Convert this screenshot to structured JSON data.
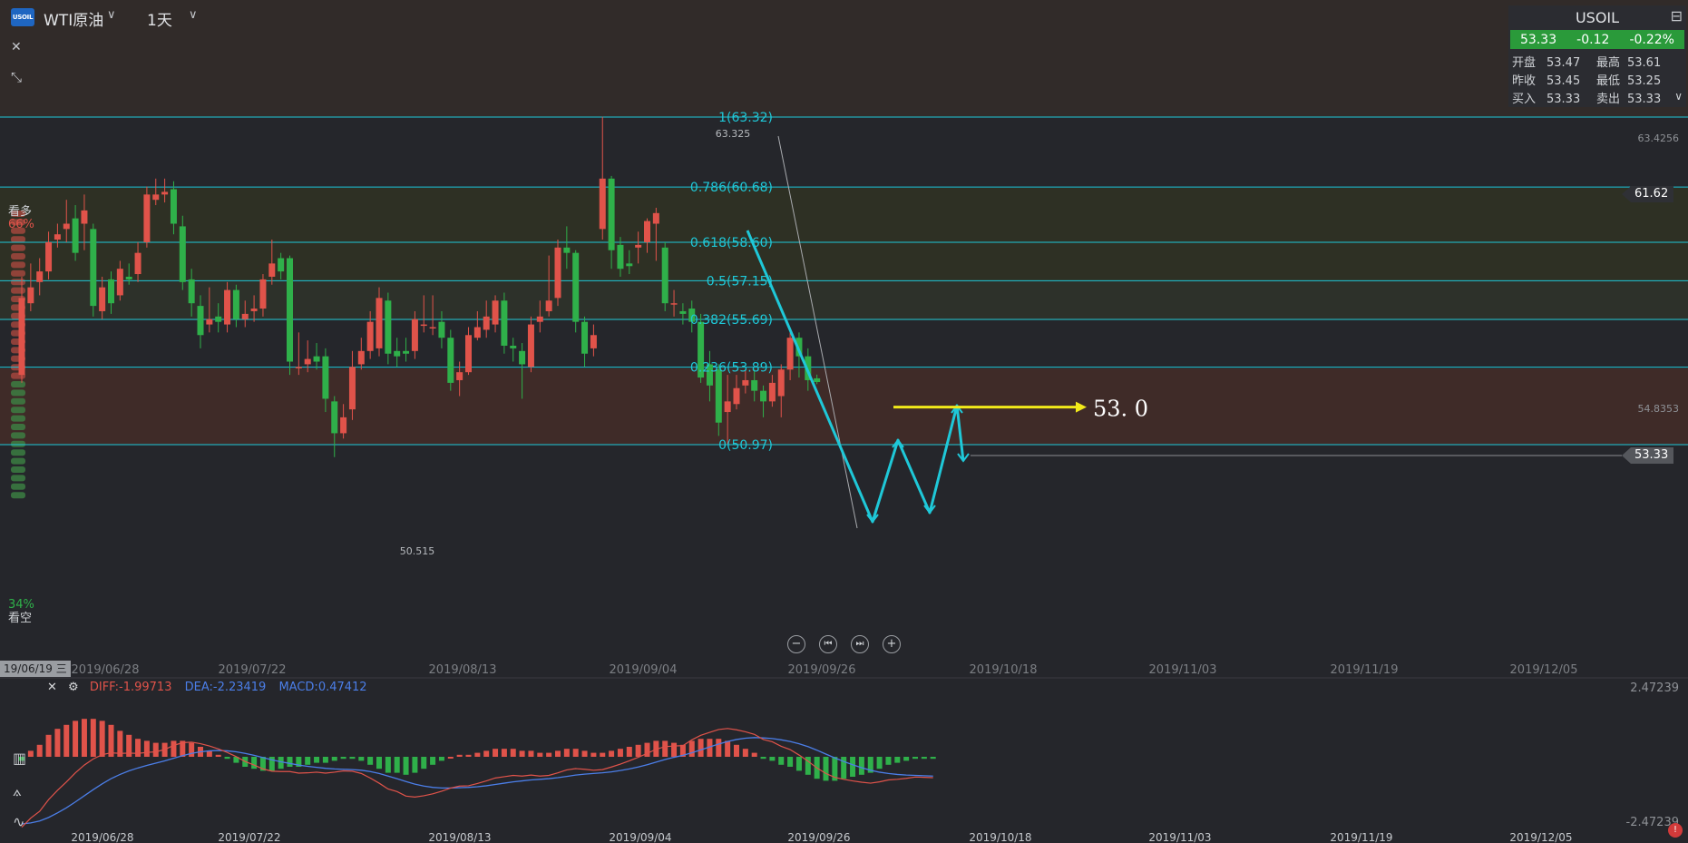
{
  "header": {
    "logo_text": "USOIL",
    "symbol_name": "WTI原油",
    "period": "1天"
  },
  "quote": {
    "title": "USOIL",
    "last": "53.33",
    "change": "-0.12",
    "change_pct": "-0.22%",
    "rows": [
      {
        "l1": "开盘",
        "v1": "53.47",
        "l2": "最高",
        "v2": "53.61"
      },
      {
        "l1": "昨收",
        "v1": "53.45",
        "l2": "最低",
        "v2": "53.25"
      },
      {
        "l1": "买入",
        "v1": "53.33",
        "l2": "卖出",
        "v2": "53.33"
      }
    ]
  },
  "sentiment": {
    "bull_label": "看多",
    "bull_pct": "66%",
    "bear_label": "看空",
    "bear_pct": "34%"
  },
  "price_axis": {
    "top_label": "63.4256",
    "mid_label": "54.8353",
    "tag_high": "61.62",
    "tag_last": "53.33"
  },
  "macd": {
    "date_badge": "19/06/19 三",
    "diff": "DIFF:-1.99713",
    "dea": "DEA:-2.23419",
    "macd": "MACD:0.47412",
    "axis_top": "2.47239",
    "axis_bottom": "-2.47239"
  },
  "colors": {
    "up": "#e0534a",
    "down": "#2fb04a",
    "fib": "#1fc8d8",
    "arrow": "#f2ea1a",
    "dea": "#4b7ee8"
  },
  "chart_data": {
    "type": "candlestick",
    "ylim": [
      49.4,
      65.6
    ],
    "x_dates": [
      "2019/06/28",
      "2019/07/22",
      "2019/08/13",
      "2019/09/04",
      "2019/09/26",
      "2019/10/18",
      "2019/11/03",
      "2019/11/19",
      "2019/12/05"
    ],
    "price_labels": {
      "high": "63.325",
      "low": "50.515"
    },
    "fib_levels": [
      {
        "label": "1(63.32)",
        "value": 63.32
      },
      {
        "label": "0.786(60.68)",
        "value": 60.68
      },
      {
        "label": "0.618(58.60)",
        "value": 58.6
      },
      {
        "label": "0.5(57.15)",
        "value": 57.15
      },
      {
        "label": "0.382(55.69)",
        "value": 55.69
      },
      {
        "label": "0.236(53.89)",
        "value": 53.89
      },
      {
        "label": "0(50.97)",
        "value": 50.97
      }
    ],
    "target_label": "53. 0",
    "target_value": 53.0,
    "candles": [
      {
        "o": 53.6,
        "c": 56.5,
        "h": 57.3,
        "l": 53.3
      },
      {
        "o": 56.3,
        "c": 56.9,
        "h": 57.8,
        "l": 56.0
      },
      {
        "o": 57.1,
        "c": 57.5,
        "h": 58.0,
        "l": 56.6
      },
      {
        "o": 57.5,
        "c": 58.6,
        "h": 59.0,
        "l": 57.2
      },
      {
        "o": 58.7,
        "c": 58.9,
        "h": 59.3,
        "l": 58.4
      },
      {
        "o": 59.1,
        "c": 59.3,
        "h": 60.2,
        "l": 58.6
      },
      {
        "o": 59.5,
        "c": 58.2,
        "h": 60.0,
        "l": 57.9
      },
      {
        "o": 59.3,
        "c": 59.8,
        "h": 60.4,
        "l": 58.3
      },
      {
        "o": 59.1,
        "c": 56.2,
        "h": 59.3,
        "l": 55.8
      },
      {
        "o": 56.0,
        "c": 56.9,
        "h": 57.3,
        "l": 55.7
      },
      {
        "o": 57.2,
        "c": 56.3,
        "h": 57.5,
        "l": 55.9
      },
      {
        "o": 56.6,
        "c": 57.6,
        "h": 57.9,
        "l": 56.4
      },
      {
        "o": 57.3,
        "c": 57.2,
        "h": 57.8,
        "l": 57.0
      },
      {
        "o": 57.4,
        "c": 58.2,
        "h": 58.6,
        "l": 57.1
      },
      {
        "o": 58.6,
        "c": 60.4,
        "h": 60.7,
        "l": 58.4
      },
      {
        "o": 60.2,
        "c": 60.4,
        "h": 61.0,
        "l": 60.0
      },
      {
        "o": 60.4,
        "c": 60.5,
        "h": 61.0,
        "l": 60.1
      },
      {
        "o": 60.6,
        "c": 59.3,
        "h": 60.9,
        "l": 58.9
      },
      {
        "o": 59.2,
        "c": 57.1,
        "h": 59.6,
        "l": 56.8
      },
      {
        "o": 57.2,
        "c": 56.3,
        "h": 57.6,
        "l": 55.8
      },
      {
        "o": 56.2,
        "c": 55.1,
        "h": 56.6,
        "l": 54.6
      },
      {
        "o": 55.5,
        "c": 55.7,
        "h": 56.9,
        "l": 55.2
      },
      {
        "o": 55.8,
        "c": 55.6,
        "h": 56.3,
        "l": 55.2
      },
      {
        "o": 55.5,
        "c": 56.8,
        "h": 57.1,
        "l": 55.2
      },
      {
        "o": 56.8,
        "c": 55.7,
        "h": 57.0,
        "l": 55.4
      },
      {
        "o": 55.7,
        "c": 55.9,
        "h": 56.4,
        "l": 55.4
      },
      {
        "o": 56.0,
        "c": 56.1,
        "h": 56.6,
        "l": 55.6
      },
      {
        "o": 56.1,
        "c": 57.2,
        "h": 57.4,
        "l": 55.8
      },
      {
        "o": 57.3,
        "c": 57.8,
        "h": 58.7,
        "l": 57.0
      },
      {
        "o": 58.0,
        "c": 57.5,
        "h": 58.2,
        "l": 57.2
      },
      {
        "o": 58.0,
        "c": 54.1,
        "h": 58.1,
        "l": 53.6
      },
      {
        "o": 53.9,
        "c": 53.9,
        "h": 55.2,
        "l": 53.6
      },
      {
        "o": 54.0,
        "c": 54.2,
        "h": 54.9,
        "l": 53.7
      },
      {
        "o": 54.3,
        "c": 54.1,
        "h": 54.8,
        "l": 53.8
      },
      {
        "o": 54.3,
        "c": 52.7,
        "h": 54.6,
        "l": 52.2
      },
      {
        "o": 52.6,
        "c": 51.4,
        "h": 52.8,
        "l": 50.5
      },
      {
        "o": 51.4,
        "c": 52.0,
        "h": 52.5,
        "l": 51.2
      },
      {
        "o": 52.3,
        "c": 53.9,
        "h": 54.5,
        "l": 51.9
      },
      {
        "o": 54.0,
        "c": 54.5,
        "h": 55.0,
        "l": 53.8
      },
      {
        "o": 54.5,
        "c": 55.6,
        "h": 56.0,
        "l": 54.2
      },
      {
        "o": 54.6,
        "c": 56.5,
        "h": 56.9,
        "l": 54.3
      },
      {
        "o": 56.4,
        "c": 54.4,
        "h": 56.7,
        "l": 54.0
      },
      {
        "o": 54.5,
        "c": 54.3,
        "h": 55.0,
        "l": 53.9
      },
      {
        "o": 54.5,
        "c": 54.4,
        "h": 55.0,
        "l": 54.1
      },
      {
        "o": 54.5,
        "c": 55.7,
        "h": 56.0,
        "l": 54.2
      },
      {
        "o": 55.5,
        "c": 55.5,
        "h": 56.6,
        "l": 55.2
      },
      {
        "o": 55.4,
        "c": 55.4,
        "h": 56.6,
        "l": 55.1
      },
      {
        "o": 55.6,
        "c": 55.0,
        "h": 56.0,
        "l": 54.6
      },
      {
        "o": 55.0,
        "c": 53.3,
        "h": 55.3,
        "l": 53.0
      },
      {
        "o": 53.4,
        "c": 53.7,
        "h": 54.1,
        "l": 52.8
      },
      {
        "o": 53.7,
        "c": 55.1,
        "h": 55.4,
        "l": 53.6
      },
      {
        "o": 55.0,
        "c": 55.4,
        "h": 56.0,
        "l": 54.9
      },
      {
        "o": 55.3,
        "c": 55.8,
        "h": 56.4,
        "l": 55.0
      },
      {
        "o": 55.5,
        "c": 56.4,
        "h": 56.6,
        "l": 55.2
      },
      {
        "o": 56.4,
        "c": 54.7,
        "h": 56.7,
        "l": 54.4
      },
      {
        "o": 54.7,
        "c": 54.6,
        "h": 55.0,
        "l": 54.1
      },
      {
        "o": 54.5,
        "c": 54.0,
        "h": 54.8,
        "l": 52.7
      },
      {
        "o": 53.9,
        "c": 55.5,
        "h": 55.8,
        "l": 53.7
      },
      {
        "o": 55.6,
        "c": 55.8,
        "h": 56.4,
        "l": 55.2
      },
      {
        "o": 56.0,
        "c": 56.4,
        "h": 58.1,
        "l": 55.8
      },
      {
        "o": 56.5,
        "c": 58.4,
        "h": 58.7,
        "l": 56.2
      },
      {
        "o": 58.4,
        "c": 58.2,
        "h": 59.2,
        "l": 57.6
      },
      {
        "o": 58.2,
        "c": 55.6,
        "h": 58.3,
        "l": 55.2
      },
      {
        "o": 55.6,
        "c": 54.4,
        "h": 55.8,
        "l": 53.9
      },
      {
        "o": 54.6,
        "c": 55.1,
        "h": 55.5,
        "l": 54.3
      },
      {
        "o": 59.1,
        "c": 61.0,
        "h": 63.33,
        "l": 58.7
      },
      {
        "o": 61.0,
        "c": 58.3,
        "h": 61.1,
        "l": 57.6
      },
      {
        "o": 58.5,
        "c": 57.6,
        "h": 58.8,
        "l": 57.3
      },
      {
        "o": 57.8,
        "c": 57.7,
        "h": 58.3,
        "l": 57.4
      },
      {
        "o": 58.4,
        "c": 58.5,
        "h": 59.0,
        "l": 57.8
      },
      {
        "o": 58.6,
        "c": 59.4,
        "h": 59.5,
        "l": 58.2
      },
      {
        "o": 59.3,
        "c": 59.7,
        "h": 59.9,
        "l": 57.9
      },
      {
        "o": 58.4,
        "c": 56.3,
        "h": 58.6,
        "l": 56.0
      },
      {
        "o": 56.3,
        "c": 56.3,
        "h": 56.8,
        "l": 55.8
      },
      {
        "o": 56.0,
        "c": 55.9,
        "h": 56.3,
        "l": 55.5
      },
      {
        "o": 56.1,
        "c": 55.6,
        "h": 56.4,
        "l": 55.2
      },
      {
        "o": 55.6,
        "c": 53.5,
        "h": 55.9,
        "l": 53.3
      },
      {
        "o": 54.0,
        "c": 53.2,
        "h": 54.5,
        "l": 52.6
      },
      {
        "o": 53.8,
        "c": 51.8,
        "h": 54.0,
        "l": 51.3
      },
      {
        "o": 52.2,
        "c": 52.6,
        "h": 53.6,
        "l": 51.0
      },
      {
        "o": 52.5,
        "c": 53.1,
        "h": 53.6,
        "l": 52.3
      },
      {
        "o": 53.2,
        "c": 53.4,
        "h": 53.8,
        "l": 52.9
      },
      {
        "o": 53.4,
        "c": 53.0,
        "h": 53.8,
        "l": 52.6
      },
      {
        "o": 53.0,
        "c": 52.6,
        "h": 53.2,
        "l": 52.0
      },
      {
        "o": 52.6,
        "c": 53.3,
        "h": 53.6,
        "l": 52.4
      },
      {
        "o": 52.8,
        "c": 53.8,
        "h": 54.0,
        "l": 52.0
      },
      {
        "o": 53.8,
        "c": 55.0,
        "h": 55.2,
        "l": 53.4
      },
      {
        "o": 55.0,
        "c": 54.3,
        "h": 55.2,
        "l": 53.5
      },
      {
        "o": 54.3,
        "c": 53.4,
        "h": 54.6,
        "l": 53.0
      },
      {
        "o": 53.47,
        "c": 53.33,
        "h": 53.61,
        "l": 53.25
      }
    ],
    "macd_hist": [
      -0.2,
      0.3,
      0.6,
      1.1,
      1.4,
      1.6,
      1.8,
      1.9,
      1.9,
      1.8,
      1.6,
      1.3,
      1.1,
      0.9,
      0.8,
      0.7,
      0.7,
      0.8,
      0.8,
      0.7,
      0.5,
      0.3,
      0.1,
      -0.1,
      -0.3,
      -0.5,
      -0.6,
      -0.7,
      -0.7,
      -0.6,
      -0.5,
      -0.5,
      -0.4,
      -0.3,
      -0.3,
      -0.2,
      -0.1,
      -0.1,
      -0.2,
      -0.4,
      -0.6,
      -0.8,
      -0.8,
      -0.9,
      -0.8,
      -0.6,
      -0.4,
      -0.2,
      0.0,
      0.1,
      0.1,
      0.2,
      0.3,
      0.4,
      0.4,
      0.4,
      0.3,
      0.3,
      0.2,
      0.2,
      0.3,
      0.4,
      0.4,
      0.3,
      0.2,
      0.2,
      0.3,
      0.4,
      0.5,
      0.6,
      0.7,
      0.8,
      0.8,
      0.7,
      0.6,
      0.8,
      0.9,
      0.9,
      0.9,
      0.8,
      0.6,
      0.4,
      0.2,
      -0.1,
      -0.2,
      -0.4,
      -0.5,
      -0.7,
      -0.9,
      -1.1,
      -1.2,
      -1.2,
      -1.1,
      -1.0,
      -0.9,
      -0.8,
      -0.6,
      -0.4,
      -0.3,
      -0.2,
      -0.1,
      -0.1,
      -0.1
    ]
  }
}
